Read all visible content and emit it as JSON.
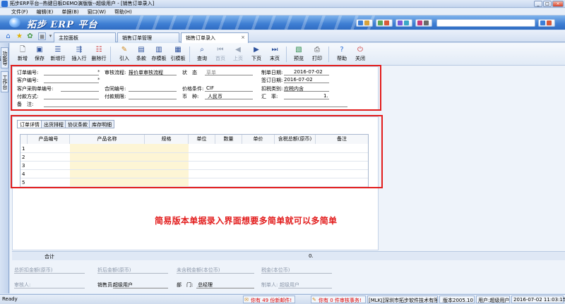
{
  "window": {
    "title": "拓步ERP平台--热键日板DEMO演版版--超级用户 - [销售订单录入]"
  },
  "menu": [
    "文件(F)",
    "编辑(E)",
    "单据(B)",
    "窗口(W)",
    "帮助(H)"
  ],
  "banner": {
    "logo": "拓步 ERP 平台"
  },
  "tabs": {
    "home": "主控面板",
    "t1": "销售订单管理",
    "t2": "销售订单录入"
  },
  "sidebar": {
    "tab1": "功能导航",
    "tab2": "工作台"
  },
  "toolbar": [
    "新增",
    "保存",
    "新增行",
    "插入行",
    "删除行",
    "引入",
    "条款",
    "存模板",
    "引模板",
    "查询",
    "首页",
    "上页",
    "下页",
    "末页",
    "预览",
    "打印",
    "帮助",
    "关闭"
  ],
  "header_form": {
    "order_no_label": "订单编号:",
    "customer_label": "客户编号:",
    "cust_po_label": "客户采购单编号:",
    "pay_method_label": "付款方式:",
    "remark_label": "备　注:",
    "approval_label": "审核流程:",
    "approval_value": "报价单审核流程",
    "contract_label": "合同编号:",
    "pay_term_label": "付款期限:",
    "status_label": "状　态",
    "status_value": "草单",
    "price_cond_label": "价格条件:",
    "price_cond_value": "CIF",
    "currency_label": "币　种:",
    "currency_value": "人民币",
    "make_date_label": "制单日期:",
    "make_date_value": "2016-07-02",
    "sign_date_label": "签订日期:",
    "sign_date_value": "2016-07-02",
    "tax_label": "扣税类别:",
    "tax_value": "应税内含",
    "rate_label": "汇　率:",
    "rate_value": "1."
  },
  "detail_tabs": [
    "订单详情",
    "出货排程",
    "协议条款",
    "库存明细"
  ],
  "grid": {
    "columns": [
      "产品编号",
      "产品名称",
      "规格",
      "单位",
      "数量",
      "单价",
      "含税总额(原币)",
      "备注"
    ],
    "rows": [
      "1",
      "2",
      "3",
      "4",
      "5"
    ]
  },
  "annotation": "简易版本单据录入界面想要多简单就可以多简单",
  "totals": {
    "label": "合计",
    "value": "0."
  },
  "footer": {
    "disc_total": "总折扣金额(原币)",
    "after_disc": "折后金额(原币)",
    "no_tax": "未含税金额(本位币)",
    "tax_amt": "税金(本位币)",
    "auditor": "审核人:",
    "salesman_label": "销售员:",
    "salesman_value": "超级用户",
    "dept_label": "部　门:",
    "dept_value": "总经理",
    "maker_label": "制单人:",
    "maker_value": "超级用户"
  },
  "status": {
    "ready": "Ready",
    "mail": "你有 49 份新邮件!",
    "tasks": "你有 0 件审核事务!",
    "company": "[MLKJ]深圳市拓步软件技术有限公",
    "version": "版本2005.10",
    "user": "用户:超级用户",
    "datetime": "2016-07-02 11:03:15"
  }
}
